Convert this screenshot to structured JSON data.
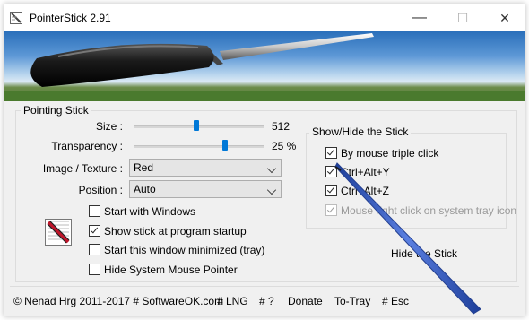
{
  "window": {
    "title": "PointerStick 2.91"
  },
  "titlebar_buttons": {
    "minimize": "—",
    "maximize": "☐",
    "close": "✕"
  },
  "pointing_stick": {
    "group_title": "Pointing Stick",
    "size": {
      "label": "Size :",
      "value": "512",
      "level_fraction": 0.47
    },
    "transparency": {
      "label": "Transparency :",
      "value": "25 %",
      "level_fraction": 0.77
    },
    "image_texture": {
      "label": "Image / Texture :",
      "selected": "Red"
    },
    "position": {
      "label": "Position :",
      "selected": "Auto"
    },
    "checkboxes": [
      {
        "label": "Start with Windows",
        "checked": false
      },
      {
        "label": "Show stick at program startup",
        "checked": true
      },
      {
        "label": "Start this window minimized (tray)",
        "checked": false
      },
      {
        "label": "Hide System Mouse Pointer",
        "checked": false
      }
    ]
  },
  "show_hide": {
    "group_title": "Show/Hide the Stick",
    "checkboxes": [
      {
        "label": "By mouse triple click",
        "checked": true,
        "disabled": false
      },
      {
        "label": "Ctrl+Alt+Y",
        "checked": true,
        "disabled": false
      },
      {
        "label": "Ctrl+Alt+Z",
        "checked": true,
        "disabled": false
      },
      {
        "label": "Mouse right click on system tray icon",
        "checked": true,
        "disabled": true
      }
    ],
    "hide_button": "Hide the Stick"
  },
  "footer": {
    "copyright": "© Nenad Hrg 2011-2017 # SoftwareOK.com",
    "lng": "# LNG",
    "help": "# ?",
    "donate": "Donate",
    "to_tray": "To-Tray",
    "esc": "# Esc"
  },
  "colors": {
    "accent": "#0078d7",
    "stick": "#2f55b8"
  }
}
